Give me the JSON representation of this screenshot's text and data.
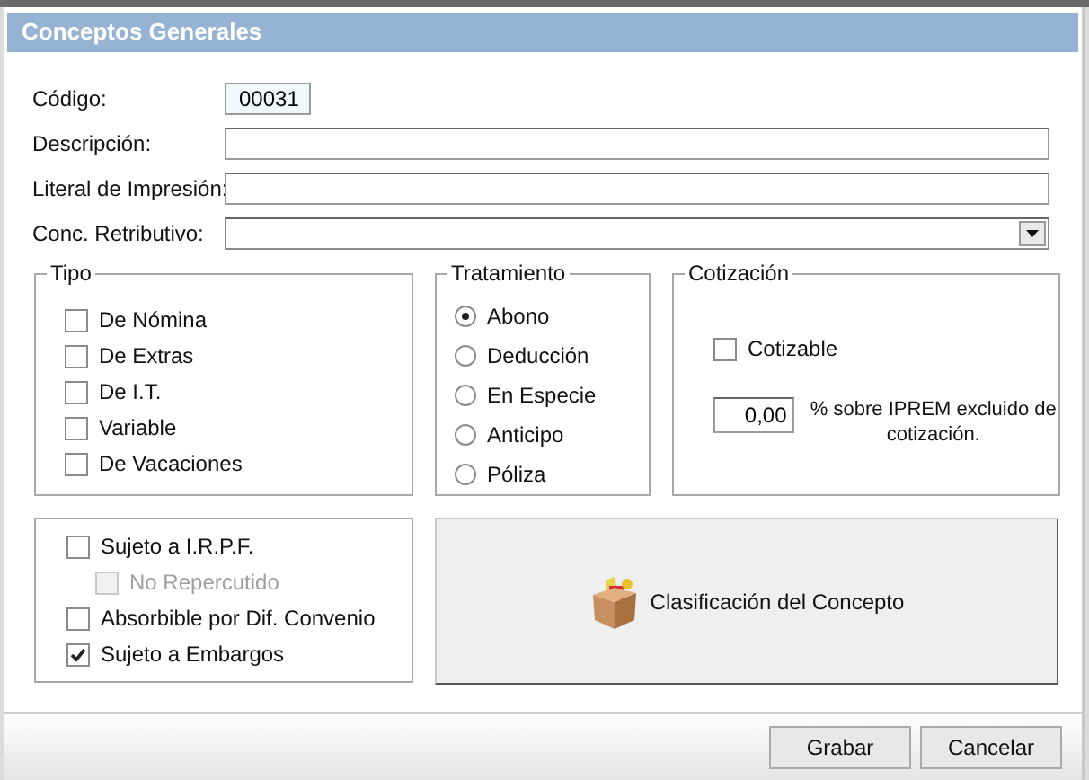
{
  "window": {
    "title": "Conceptos Generales"
  },
  "fields": [
    {
      "kind": "text",
      "label": "Código:",
      "value": "00031"
    },
    {
      "kind": "text",
      "label": "Descripción:"
    },
    {
      "kind": "text",
      "label": "Literal de Impresión:"
    },
    {
      "kind": "combo",
      "label": "Conc. Retributivo:"
    }
  ],
  "tipo": {
    "title": "Tipo",
    "items": [
      {
        "label": "De Nómina",
        "checked": false
      },
      {
        "label": "De Extras",
        "checked": false
      },
      {
        "label": "De I.T.",
        "checked": false
      },
      {
        "label": "Variable",
        "checked": false
      },
      {
        "label": "De Vacaciones",
        "checked": false
      }
    ]
  },
  "tratamiento": {
    "title": "Tratamiento",
    "options": [
      {
        "label": "Abono",
        "selected": true
      },
      {
        "label": "Deducción",
        "selected": false
      },
      {
        "label": "En Especie",
        "selected": false
      },
      {
        "label": "Anticipo",
        "selected": false
      },
      {
        "label": "Póliza",
        "selected": false
      }
    ]
  },
  "cotizacion": {
    "title": "Cotización",
    "cotizable": {
      "label": "Cotizable",
      "checked": false
    },
    "percent_value": "0,00",
    "percent_label": "% sobre IPREM excluido de cotización."
  },
  "flags": [
    {
      "label": "Sujeto a I.R.P.F.",
      "checked": false,
      "disabled": false,
      "children": [
        {
          "label": "No Repercutido",
          "checked": false,
          "disabled": true
        }
      ]
    },
    {
      "label": "Absorbible por Dif. Convenio",
      "checked": false,
      "disabled": false
    },
    {
      "label": "Sujeto a Embargos",
      "checked": true,
      "disabled": false
    }
  ],
  "classify_button": "Clasificación del Concepto",
  "buttons": [
    "Grabar",
    "Cancelar"
  ]
}
